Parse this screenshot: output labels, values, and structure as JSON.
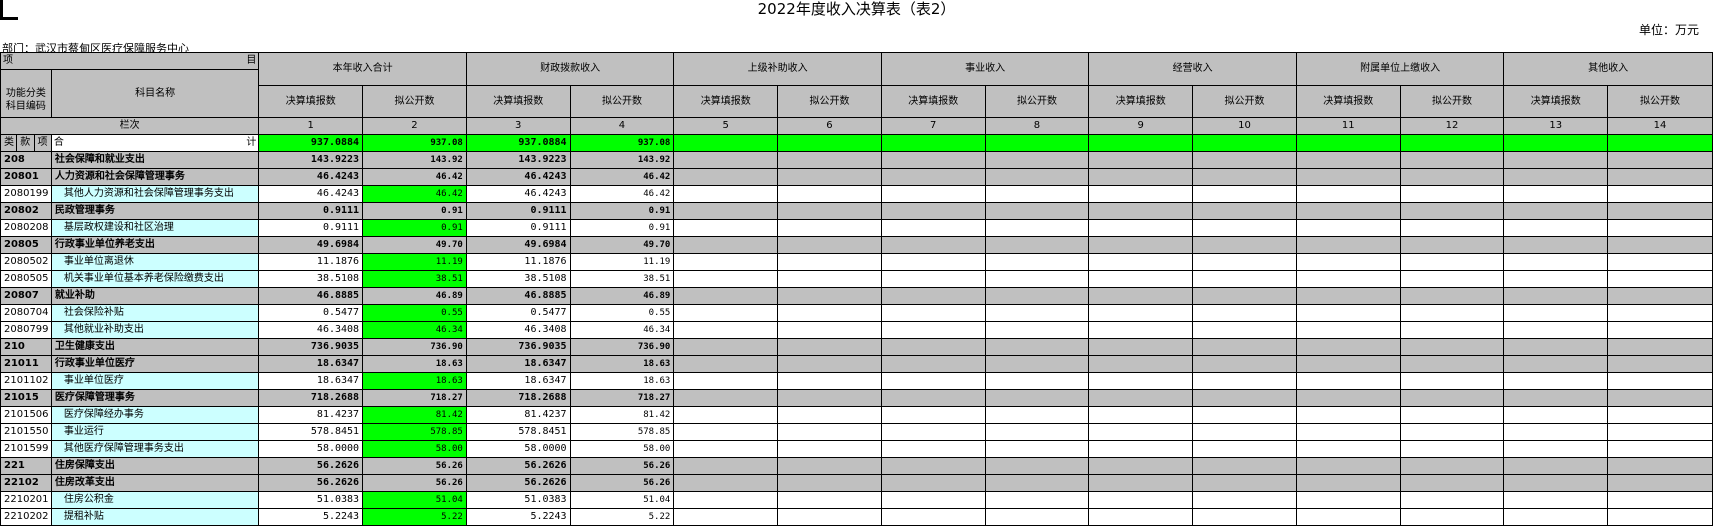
{
  "title": "2022年度收入决算表（表2）",
  "unit": "单位：万元",
  "department": "部门：武汉市蔡甸区医疗保障服务中心",
  "header": {
    "item_left": "项",
    "item_right": "目",
    "func_code": "功能分类\n科目编码",
    "subject_name": "科目名称",
    "col_index_label": "栏次",
    "lei": "类",
    "kuan": "款",
    "xiang": "项",
    "he": "合",
    "ji": "计",
    "groups": [
      "本年收入合计",
      "财政拨款收入",
      "上级补助收入",
      "事业收入",
      "经营收入",
      "附属单位上缴收入",
      "其他收入"
    ],
    "sub_a": "决算填报数",
    "sub_b": "拟公开数",
    "col_numbers": [
      "1",
      "2",
      "3",
      "4",
      "5",
      "6",
      "7",
      "8",
      "9",
      "10",
      "11",
      "12",
      "13",
      "14"
    ]
  },
  "total": [
    "937.0884",
    "937.08",
    "937.0884",
    "937.08"
  ],
  "rows": [
    {
      "code": "208",
      "name": "社会保障和就业支出",
      "level": "bold",
      "vals": [
        "143.9223",
        "143.92",
        "143.9223",
        "143.92"
      ]
    },
    {
      "code": "20801",
      "name": "人力资源和社会保障管理事务",
      "level": "bold",
      "vals": [
        "46.4243",
        "46.42",
        "46.4243",
        "46.42"
      ]
    },
    {
      "code": "2080199",
      "name": "其他人力资源和社会保障管理事务支出",
      "level": "leaf",
      "vals": [
        "46.4243",
        "46.42",
        "46.4243",
        "46.42"
      ]
    },
    {
      "code": "20802",
      "name": "民政管理事务",
      "level": "bold",
      "vals": [
        "0.9111",
        "0.91",
        "0.9111",
        "0.91"
      ]
    },
    {
      "code": "2080208",
      "name": "基层政权建设和社区治理",
      "level": "leaf",
      "vals": [
        "0.9111",
        "0.91",
        "0.9111",
        "0.91"
      ]
    },
    {
      "code": "20805",
      "name": "行政事业单位养老支出",
      "level": "bold",
      "vals": [
        "49.6984",
        "49.70",
        "49.6984",
        "49.70"
      ]
    },
    {
      "code": "2080502",
      "name": "事业单位离退休",
      "level": "leaf",
      "vals": [
        "11.1876",
        "11.19",
        "11.1876",
        "11.19"
      ]
    },
    {
      "code": "2080505",
      "name": "机关事业单位基本养老保险缴费支出",
      "level": "leaf",
      "vals": [
        "38.5108",
        "38.51",
        "38.5108",
        "38.51"
      ]
    },
    {
      "code": "20807",
      "name": "就业补助",
      "level": "bold",
      "vals": [
        "46.8885",
        "46.89",
        "46.8885",
        "46.89"
      ]
    },
    {
      "code": "2080704",
      "name": "社会保险补贴",
      "level": "leaf",
      "vals": [
        "0.5477",
        "0.55",
        "0.5477",
        "0.55"
      ]
    },
    {
      "code": "2080799",
      "name": "其他就业补助支出",
      "level": "leaf",
      "vals": [
        "46.3408",
        "46.34",
        "46.3408",
        "46.34"
      ]
    },
    {
      "code": "210",
      "name": "卫生健康支出",
      "level": "bold",
      "vals": [
        "736.9035",
        "736.90",
        "736.9035",
        "736.90"
      ]
    },
    {
      "code": "21011",
      "name": "行政事业单位医疗",
      "level": "bold",
      "vals": [
        "18.6347",
        "18.63",
        "18.6347",
        "18.63"
      ]
    },
    {
      "code": "2101102",
      "name": "事业单位医疗",
      "level": "leaf",
      "vals": [
        "18.6347",
        "18.63",
        "18.6347",
        "18.63"
      ]
    },
    {
      "code": "21015",
      "name": "医疗保障管理事务",
      "level": "bold",
      "vals": [
        "718.2688",
        "718.27",
        "718.2688",
        "718.27"
      ]
    },
    {
      "code": "2101506",
      "name": "医疗保障经办事务",
      "level": "leaf",
      "vals": [
        "81.4237",
        "81.42",
        "81.4237",
        "81.42"
      ]
    },
    {
      "code": "2101550",
      "name": "事业运行",
      "level": "leaf",
      "vals": [
        "578.8451",
        "578.85",
        "578.8451",
        "578.85"
      ]
    },
    {
      "code": "2101599",
      "name": "其他医疗保障管理事务支出",
      "level": "leaf",
      "vals": [
        "58.0000",
        "58.00",
        "58.0000",
        "58.00"
      ]
    },
    {
      "code": "221",
      "name": "住房保障支出",
      "level": "bold",
      "vals": [
        "56.2626",
        "56.26",
        "56.2626",
        "56.26"
      ]
    },
    {
      "code": "22102",
      "name": "住房改革支出",
      "level": "bold",
      "vals": [
        "56.2626",
        "56.26",
        "56.2626",
        "56.26"
      ]
    },
    {
      "code": "2210201",
      "name": "住房公积金",
      "level": "leaf",
      "vals": [
        "51.0383",
        "51.04",
        "51.0383",
        "51.04"
      ]
    },
    {
      "code": "2210202",
      "name": "提租补贴",
      "level": "leaf",
      "vals": [
        "5.2243",
        "5.22",
        "5.2243",
        "5.22"
      ]
    }
  ]
}
